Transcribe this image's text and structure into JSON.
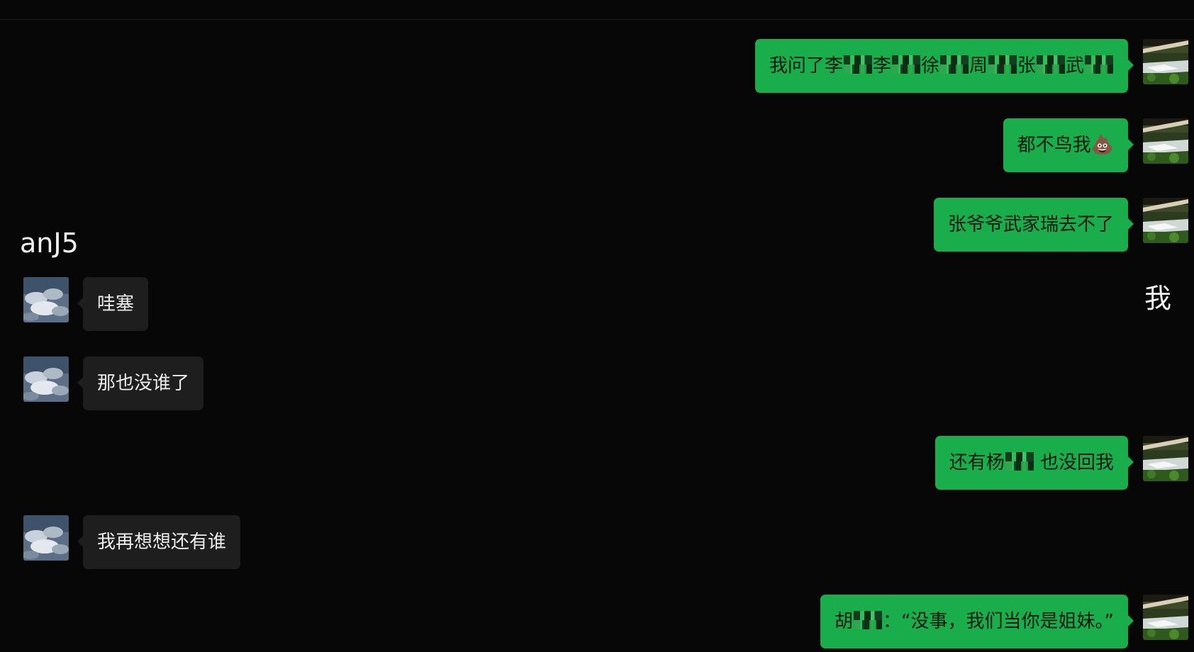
{
  "contacts": {
    "other_name": "anJ5",
    "self_name": "我"
  },
  "messages": [
    {
      "side": "out",
      "segments": [
        {
          "text": "我问了李"
        },
        {
          "redacted": 2
        },
        {
          "text": "李"
        },
        {
          "redacted": 2
        },
        {
          "text": "徐"
        },
        {
          "redacted": 2
        },
        {
          "text": "周"
        },
        {
          "redacted": 2
        },
        {
          "text": "张"
        },
        {
          "redacted": 2
        },
        {
          "text": "武"
        },
        {
          "redacted": 2
        }
      ]
    },
    {
      "side": "out",
      "segments": [
        {
          "text": "都不鸟我"
        },
        {
          "emoji": "💩"
        }
      ]
    },
    {
      "side": "out",
      "segments": [
        {
          "text": "张爷爷武家瑞去不了"
        }
      ]
    },
    {
      "side": "in",
      "segments": [
        {
          "text": "哇塞"
        }
      ]
    },
    {
      "side": "in",
      "segments": [
        {
          "text": "那也没谁了"
        }
      ]
    },
    {
      "side": "out",
      "segments": [
        {
          "text": "还有杨"
        },
        {
          "redacted": 2
        },
        {
          "text": " 也没回我"
        }
      ]
    },
    {
      "side": "in",
      "segments": [
        {
          "text": "我再想想还有谁"
        }
      ]
    },
    {
      "side": "out",
      "segments": [
        {
          "text": "胡"
        },
        {
          "redacted": 2
        },
        {
          "text": "：“没事，我们当你是姐妹。”"
        }
      ]
    }
  ],
  "avatars": {
    "self_icon": "landscape-photo-avatar",
    "other_icon": "cloudy-sky-avatar"
  },
  "colors": {
    "background": "#070707",
    "outgoing_bubble": "#1aad4c",
    "incoming_bubble": "#1e1e1e"
  }
}
